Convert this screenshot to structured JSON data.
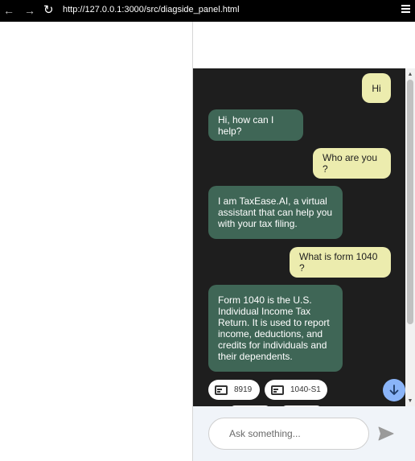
{
  "browser": {
    "back_glyph": "←",
    "forward_glyph": "→",
    "reload_glyph": "↻",
    "url": "http://127.0.0.1:3000/src/diagside_panel.html",
    "icons": [
      "back-arrow-icon",
      "forward-arrow-icon",
      "reload-icon",
      "hamburger-menu-icon"
    ]
  },
  "chat": {
    "messages": [
      {
        "sender": "user",
        "text": "Hi"
      },
      {
        "sender": "bot",
        "text": "Hi, how can I help?"
      },
      {
        "sender": "user",
        "text": "Who are you ?"
      },
      {
        "sender": "bot",
        "text": "I am TaxEase.AI, a virtual assistant that can help you with your tax filing."
      },
      {
        "sender": "user",
        "text": "What is form 1040 ?"
      },
      {
        "sender": "bot",
        "text": "Form 1040 is the U.S. Individual Income Tax Return. It is used to report income, deductions, and credits for individuals and their dependents."
      }
    ],
    "suggestions": [
      {
        "label": "8919",
        "icon": "form-document-icon"
      },
      {
        "label": "1040-S1",
        "icon": "form-document-icon"
      }
    ],
    "scroll_down_icon": "arrow-down-icon"
  },
  "input": {
    "placeholder": "Ask something...",
    "value": "",
    "send_icon": "send-icon"
  },
  "colors": {
    "chat_background": "#1e1e1e",
    "user_bubble": "#ececae",
    "bot_bubble": "#3f6656",
    "scroll_button": "#8ab4f8",
    "input_bar": "#f0f4f9"
  }
}
